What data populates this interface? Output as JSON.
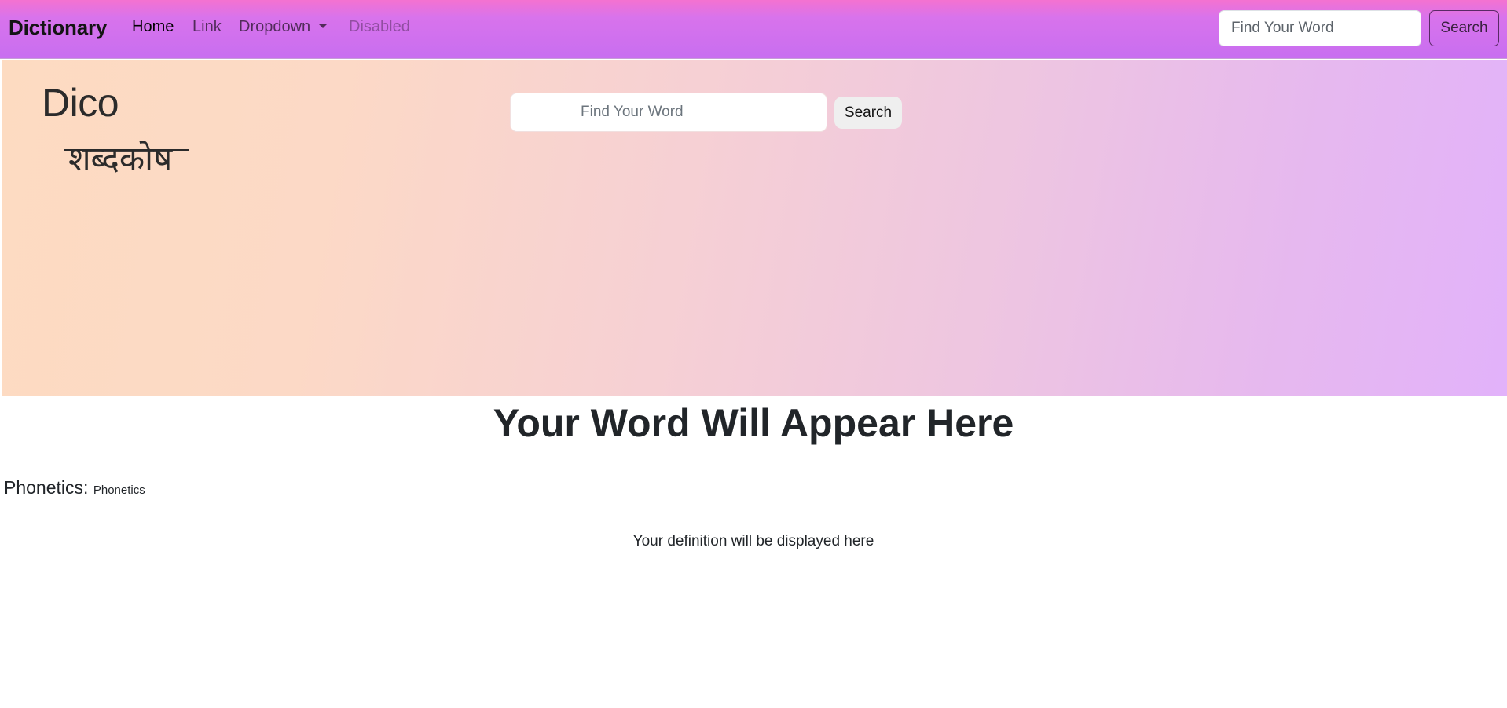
{
  "navbar": {
    "brand": "Dictionary",
    "links": [
      {
        "label": "Home",
        "state": "active"
      },
      {
        "label": "Link",
        "state": "normal"
      },
      {
        "label": "Dropdown",
        "state": "dropdown"
      },
      {
        "label": "Disabled",
        "state": "disabled"
      }
    ],
    "search_placeholder": "Find Your Word",
    "search_button": "Search",
    "icons": {
      "dropdown": "caret-down-icon"
    }
  },
  "hero": {
    "logo_en": "Dico",
    "logo_hi": "शब्दकोष",
    "search_placeholder": "Find Your Word",
    "search_button": "Search"
  },
  "content": {
    "word_title": "Your Word Will Appear Here",
    "phonetics_label": "Phonetics:",
    "phonetics_value": "Phonetics",
    "definition": "Your definition will be displayed here"
  },
  "colors": {
    "navbar_top": "#f472d0",
    "navbar_bottom": "#c86ef0",
    "hero_left": "#fddbc1",
    "hero_right": "#e2b2fa",
    "text": "#212529"
  }
}
